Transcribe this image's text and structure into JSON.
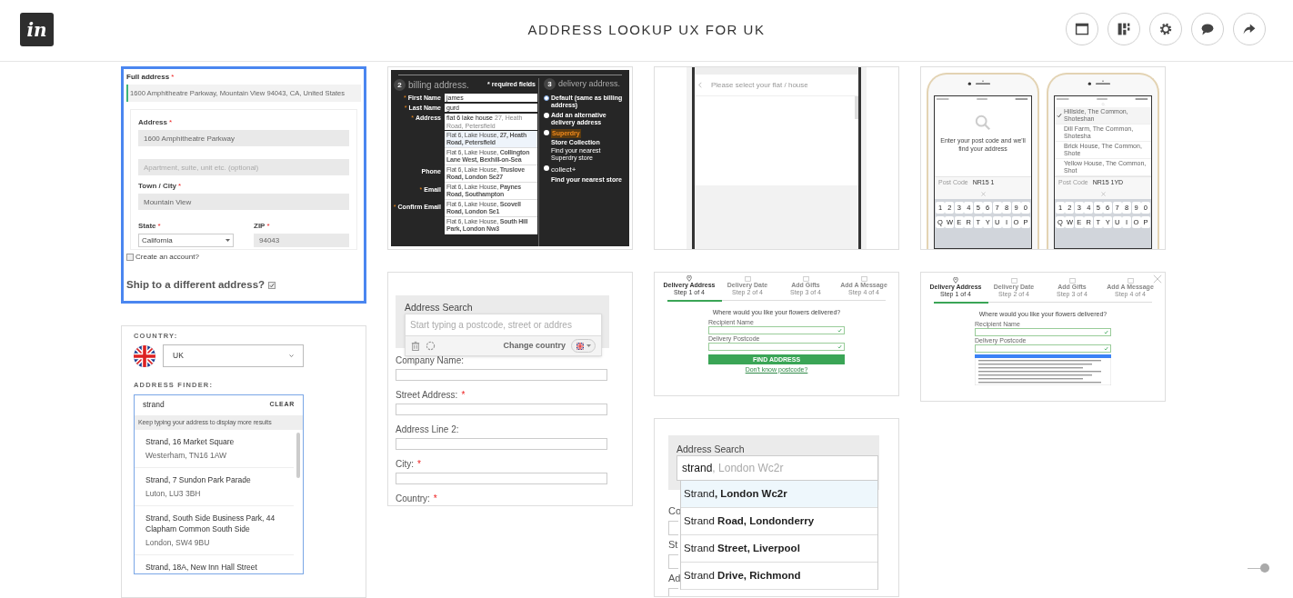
{
  "header": {
    "logo": "in",
    "title": "ADDRESS LOOKUP UX FOR UK"
  },
  "zoom_slider": {
    "level": 1
  },
  "columns": [
    {
      "cards": [
        {
          "kind": "checkout",
          "selected": true,
          "full_label": "Full address",
          "full_mark": "*",
          "full_value": "1600 Amphitheatre Parkway, Mountain View 94043, CA, United States",
          "fields": [
            {
              "label": "Address",
              "mark": "*",
              "value": "1600 Amphitheatre Parkway"
            },
            {
              "placeholder": "Apartment, suite, unit etc. (optional)"
            },
            {
              "label": "Town / City",
              "mark": "*",
              "value": "Mountain View"
            }
          ],
          "state": {
            "label": "State",
            "mark": "*",
            "value": "California"
          },
          "zip": {
            "label": "ZIP",
            "mark": "*",
            "value": "94043"
          },
          "checks": [
            {
              "kind": "small",
              "label": "Create an account?",
              "checked": false
            },
            {
              "kind": "large",
              "label": "Ship to a different address?",
              "checked": true
            }
          ]
        },
        {
          "kind": "finder",
          "selected": false,
          "country_label": "COUNTRY:",
          "country": "UK",
          "finder_label": "ADDRESS FINDER:",
          "query": "strand",
          "clear": "CLEAR",
          "hint": "Keep typing your address to display more results",
          "results": [
            {
              "lines": [
                "Strand, 16 Market Square",
                "Westerham, TN16 1AW"
              ]
            },
            {
              "lines": [
                "Strand, 7 Sundon Park Parade",
                "Luton, LU3 3BH"
              ]
            },
            {
              "lines": [
                "Strand, South Side Business Park, 44 Clapham Common South Side",
                "London, SW4 9BU"
              ]
            },
            {
              "lines": [
                "Strand, 18A, New Inn Hall Street"
              ]
            }
          ]
        }
      ]
    },
    {
      "cards": [
        {
          "kind": "billing",
          "selected": false,
          "step": "2",
          "heading": "billing address.",
          "required_note": "* required fields",
          "fields": [
            {
              "label": "First Name",
              "mark": "*",
              "value": "james"
            },
            {
              "label": "Last Name",
              "mark": "*",
              "value": "gurd"
            },
            {
              "label": "Address",
              "mark": "*",
              "value": "flat 6 lake house",
              "completion": "27, Heath Road, Petersfield"
            }
          ],
          "suggestions": [
            "Flat 6, Lake House, **27, Heath Road, Petersfield**",
            "Flat 6, Lake House, **Collington Lane West, Bexhill-on-Sea**",
            "Flat 6, Lake House, **Truslove Road, London Se27**",
            "Flat 6, Lake House, **Paynes Road, Southampton**",
            "Flat 6, Lake House, **Scovell Road, London Se1**",
            "Flat 6, Lake House, **South Hill Park, London Nw3**"
          ],
          "more_fields": [
            {
              "label": "Phone"
            },
            {
              "label": "Email",
              "mark": "*"
            },
            {
              "label": "Confirm Email",
              "mark": "*"
            }
          ],
          "step2": "3",
          "heading2": "delivery address.",
          "options": [
            {
              "label": "Default (same as billing address)",
              "selected": true
            },
            {
              "label": "Add an alternative delivery address",
              "selected": false
            },
            {
              "brand": "Superdry",
              "label": "Store Collection",
              "note": "Find your nearest Superdry store",
              "selected": false
            },
            {
              "brand": "collect+",
              "label": "Find your nearest store",
              "selected": false
            }
          ]
        },
        {
          "kind": "search_form",
          "selected": false,
          "title": "Address Search",
          "placeholder": "Start typing a postcode, street or addres",
          "change_country": "Change country",
          "fields": [
            {
              "label": "Company Name:"
            },
            {
              "label": "Street Address:",
              "mark": "*"
            },
            {
              "label": "Address Line 2:"
            },
            {
              "label": "City:",
              "mark": "*"
            },
            {
              "label": "Country:",
              "mark": "*"
            }
          ]
        }
      ]
    },
    {
      "cards": [
        {
          "kind": "flat_select",
          "selected": false,
          "title": "Please select your flat / house"
        },
        {
          "kind": "flowers",
          "selected": false,
          "steps": [
            {
              "label": "Delivery Address",
              "sub": "Step 1 of 4",
              "selected": true
            },
            {
              "label": "Delivery Date",
              "sub": "Step 2 of 4",
              "selected": false
            },
            {
              "label": "Add Gifts",
              "sub": "Step 3 of 4",
              "selected": false
            },
            {
              "label": "Add A Message",
              "sub": "Step 4 of 4",
              "selected": false
            }
          ],
          "question": "Where would you like your flowers delivered?",
          "fields": [
            "Recipient Name",
            "Delivery Postcode"
          ],
          "button": "FIND ADDRESS",
          "link": "Don't know postcode?"
        },
        {
          "kind": "strand",
          "selected": false,
          "title": "Address Search",
          "query": "strand",
          "completion": ", London Wc2r",
          "behind_labels": [
            "Co",
            "St",
            "Ad"
          ],
          "options": [
            {
              "text": "Strand**, London Wc2r**",
              "selected": true
            },
            {
              "text": "Strand **Road, Londonderry**",
              "selected": false
            },
            {
              "text": "Strand **Street, Liverpool**",
              "selected": false
            },
            {
              "text": "Strand **Drive, Richmond**",
              "selected": false
            }
          ]
        }
      ]
    },
    {
      "cards": [
        {
          "kind": "phones",
          "selected": false,
          "phones": [
            {
              "kind": "prompt",
              "prompt": "Enter your post code and we'll find your address",
              "postcode_label": "Post Code",
              "postcode": "NR15 1",
              "keys": [
                [
                  "1",
                  "2",
                  "3",
                  "4",
                  "5",
                  "6",
                  "7",
                  "8",
                  "9",
                  "0"
                ],
                [
                  "Q",
                  "W",
                  "E",
                  "R",
                  "T",
                  "Y",
                  "U",
                  "I",
                  "O",
                  "P"
                ]
              ]
            },
            {
              "kind": "results",
              "results": [
                {
                  "text": "Hillside, The Common, Shoteshan",
                  "selected": true
                },
                {
                  "text": "Dill Farm, The Common, Shotesha",
                  "selected": false
                },
                {
                  "text": "Brick House, The Common, Shote",
                  "selected": false
                },
                {
                  "text": "Yellow House, The Common, Shot",
                  "selected": false
                }
              ],
              "postcode_label": "Post Code",
              "postcode": "NR15 1YD",
              "keys": [
                [
                  "1",
                  "2",
                  "3",
                  "4",
                  "5",
                  "6",
                  "7",
                  "8",
                  "9",
                  "0"
                ],
                [
                  "Q",
                  "W",
                  "E",
                  "R",
                  "T",
                  "Y",
                  "U",
                  "I",
                  "O",
                  "P"
                ]
              ]
            }
          ]
        },
        {
          "kind": "flowers_list",
          "selected": false,
          "steps": [
            {
              "label": "Delivery Address",
              "sub": "Step 1 of 4",
              "selected": true
            },
            {
              "label": "Delivery Date",
              "sub": "Step 2 of 4",
              "selected": false
            },
            {
              "label": "Add Gifts",
              "sub": "Step 3 of 4",
              "selected": false
            },
            {
              "label": "Add A Message",
              "sub": "Step 4 of 4",
              "selected": false
            }
          ],
          "question": "Where would you like your flowers delivered?",
          "fields": [
            "Recipient Name",
            "Delivery Postcode"
          ]
        }
      ]
    }
  ]
}
